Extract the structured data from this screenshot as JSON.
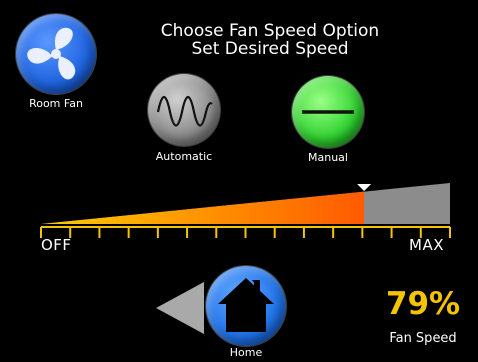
{
  "header": {
    "line1": "Choose Fan Speed Option",
    "line2": "Set Desired Speed"
  },
  "room_fan": {
    "label": "Room Fan",
    "icon": "fan-icon",
    "color": "#1e64e0"
  },
  "modes": [
    {
      "label": "Automatic",
      "icon": "sine-wave-icon",
      "color": "#8a8a8a",
      "selected": false
    },
    {
      "label": "Manual",
      "icon": "flat-line-icon",
      "color": "#2fd12f",
      "selected": true
    }
  ],
  "speed_slider": {
    "min_label": "OFF",
    "max_label": "MAX",
    "value_fraction": 0.79,
    "fill_start_color": "#ffcc00",
    "fill_end_color": "#ff5a00",
    "track_color": "#8c8c8c",
    "tick_color": "#f5c400"
  },
  "navigation": {
    "back_icon": "back-triangle-icon",
    "home_label": "Home",
    "home_icon": "home-icon"
  },
  "fan_speed": {
    "value": "79%",
    "label": "Fan Speed"
  }
}
